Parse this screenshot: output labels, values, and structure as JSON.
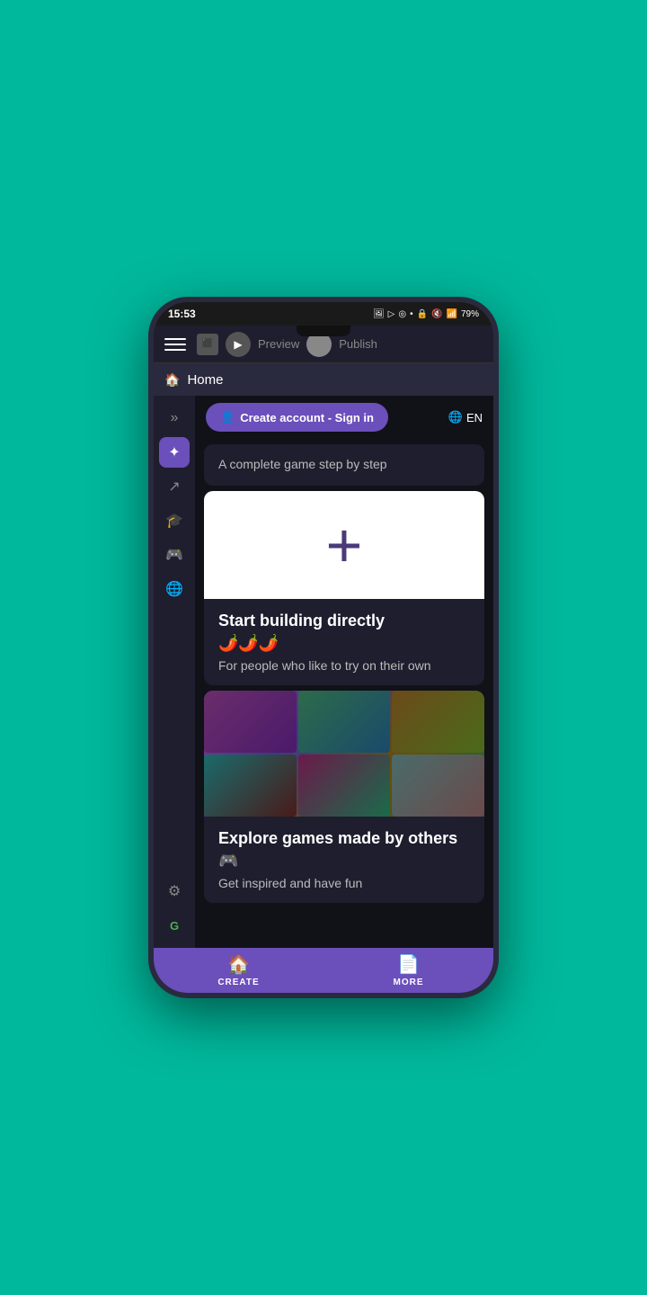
{
  "status_bar": {
    "time": "15:53",
    "battery": "79%",
    "signal": "79"
  },
  "top_bar": {
    "preview_label": "Preview",
    "publish_label": "Publish"
  },
  "home_bar": {
    "label": "Home"
  },
  "create_account_btn": {
    "label": "Create account - Sign in"
  },
  "lang": {
    "label": "EN"
  },
  "cards": [
    {
      "id": "guided",
      "subtitle": "A complete game step by step"
    },
    {
      "id": "build",
      "title": "Start building directly",
      "emoji": "🌶️🌶️🌶️",
      "desc": "For people who like to try on their own"
    },
    {
      "id": "explore",
      "title": "Explore games made by others",
      "emoji": "🎮",
      "desc": "Get inspired and have fun"
    }
  ],
  "bottom_nav": {
    "create_label": "CREATE",
    "more_label": "MORE"
  },
  "sidebar": {
    "items": [
      {
        "icon": "»",
        "name": "expand"
      },
      {
        "icon": "✦",
        "name": "effects",
        "active": true
      },
      {
        "icon": "↗",
        "name": "arrow"
      },
      {
        "icon": "🎓",
        "name": "learn"
      },
      {
        "icon": "🎮",
        "name": "gamepad"
      },
      {
        "icon": "🌐",
        "name": "globe"
      },
      {
        "icon": "⚙",
        "name": "settings"
      },
      {
        "icon": "G",
        "name": "grammarly"
      }
    ]
  }
}
